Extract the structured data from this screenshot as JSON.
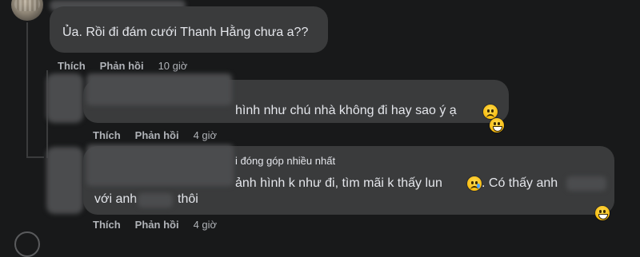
{
  "comments": [
    {
      "id": "c1",
      "text": "Ủa. Rồi đi đám cưới Thanh Hằng chưa a??",
      "actions": {
        "like": "Thích",
        "reply": "Phản hồi",
        "time": "10 giờ"
      }
    },
    {
      "id": "c2",
      "text": "hình như chú nhà không đi hay sao ý ạ",
      "actions": {
        "like": "Thích",
        "reply": "Phản hồi",
        "time": "4 giờ"
      },
      "emojis": [
        "sad-face-emoji",
        "grinning-face-emoji"
      ]
    },
    {
      "id": "c3",
      "badge": "i đóng góp nhiều nhất",
      "line1": "ảnh hình k như đi, tìm mãi k thấy lun",
      "line1_tail": ". Có thấy anh",
      "line2_a": "với anh",
      "line2_b": "thôi",
      "actions": {
        "like": "Thích",
        "reply": "Phản hồi",
        "time": "4 giờ"
      },
      "emojis": [
        "crying-face-emoji",
        "grinning-face-emoji"
      ]
    }
  ],
  "colors": {
    "background": "#18191a",
    "bubble": "#3a3b3c",
    "text": "#e4e6eb",
    "secondary": "#b0b3b8"
  }
}
